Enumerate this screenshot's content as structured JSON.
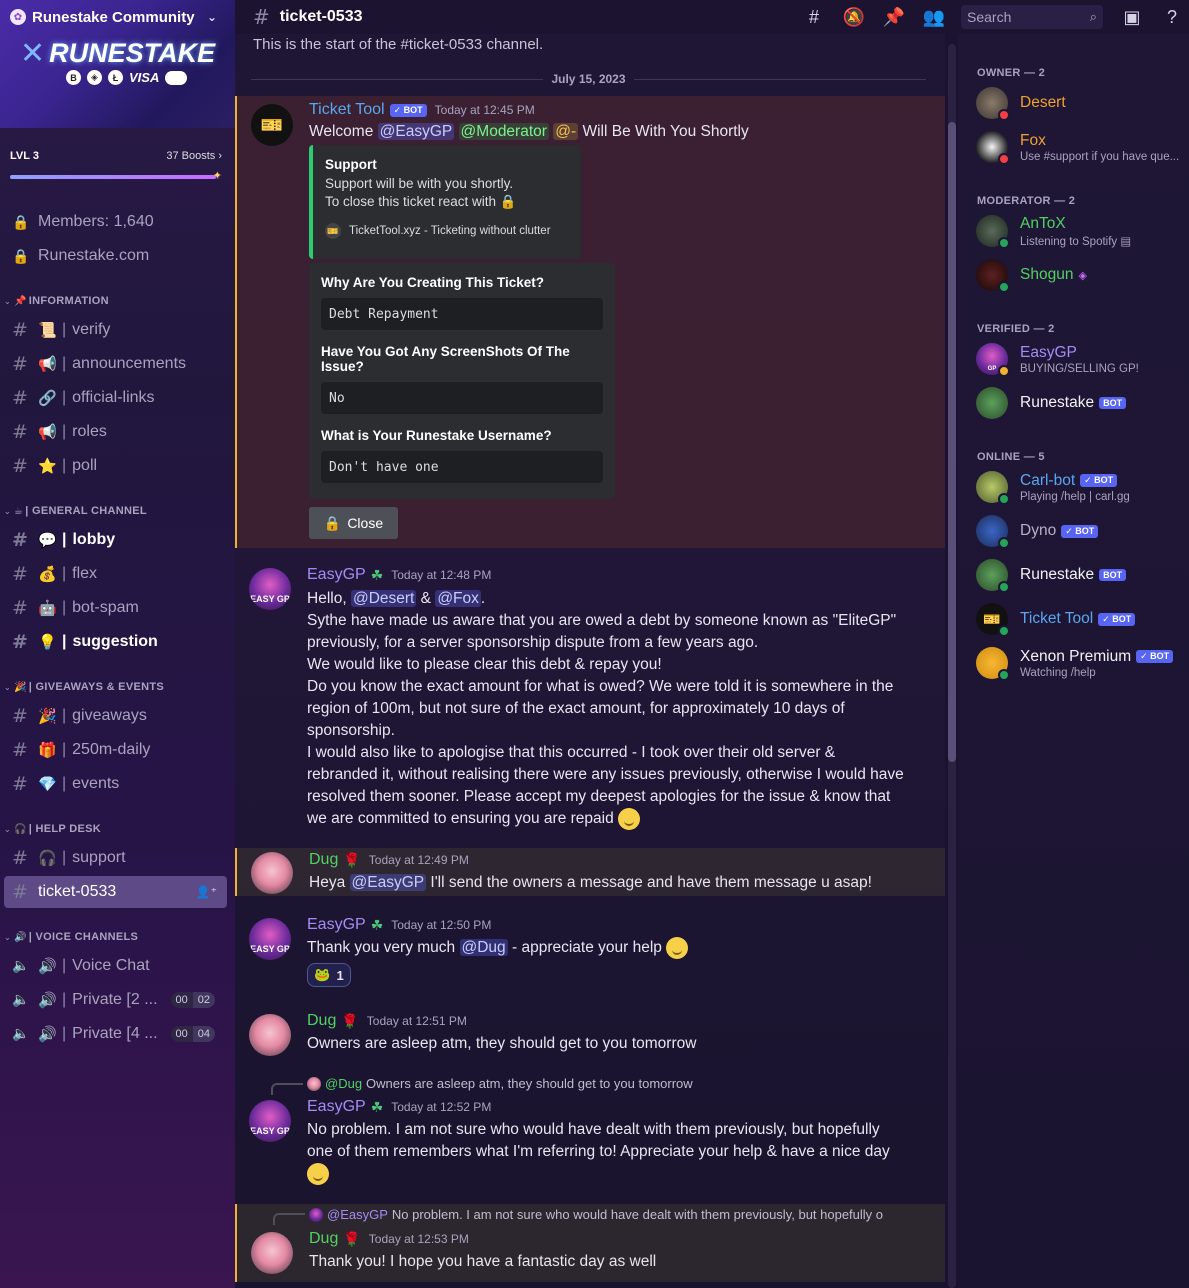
{
  "server": {
    "name": "Runestake Community",
    "banner_word": "RUNESTAKE",
    "banner_payments": [
      "B",
      "◈",
      "Ł",
      "VISA"
    ],
    "level": "LVL 3",
    "boosts": "37 Boosts",
    "boost_progress": 0.98
  },
  "sidebar": {
    "locked": [
      {
        "label": "Members: 1,640"
      },
      {
        "label": "Runestake.com"
      }
    ],
    "categories": [
      {
        "label": "INFORMATION",
        "emoji": "📌"
      },
      {
        "label": "| GENERAL CHANNEL",
        "emoji": "☕"
      },
      {
        "label": "| GIVEAWAYS & EVENTS",
        "emoji": "🎉"
      },
      {
        "label": "| HELP DESK",
        "emoji": "🎧"
      },
      {
        "label": "| VOICE CHANNELS",
        "emoji": "🔊"
      }
    ],
    "channels": [
      {
        "emoji": "📜",
        "label": "verify"
      },
      {
        "emoji": "📢",
        "label": "announcements"
      },
      {
        "emoji": "🔗",
        "label": "official-links"
      },
      {
        "emoji": "📢",
        "label": "roles"
      },
      {
        "emoji": "⭐",
        "label": "poll"
      },
      {
        "emoji": "💬",
        "label": "lobby"
      },
      {
        "emoji": "💰",
        "label": "flex"
      },
      {
        "emoji": "🤖",
        "label": "bot-spam"
      },
      {
        "emoji": "💡",
        "label": "suggestion"
      },
      {
        "emoji": "🎉",
        "label": "giveaways"
      },
      {
        "emoji": "🎁",
        "label": "250m-daily"
      },
      {
        "emoji": "💎",
        "label": "events"
      },
      {
        "emoji": "🎧",
        "label": "support"
      },
      {
        "emoji": "",
        "label": "ticket-0533"
      },
      {
        "emoji": "🔊",
        "label": "Voice Chat"
      },
      {
        "emoji": "🔊",
        "label": "Private [2 ...",
        "count_a": "00",
        "count_b": "02"
      },
      {
        "emoji": "🔊",
        "label": "Private [4 ...",
        "count_a": "00",
        "count_b": "04"
      }
    ]
  },
  "topbar": {
    "channel": "ticket-0533",
    "search_placeholder": "Search"
  },
  "chat": {
    "start_text": "This is the start of the #ticket-0533 channel.",
    "date": "July 15, 2023",
    "messages": [
      {
        "author": "Ticket Tool",
        "bot": "✓ BOT",
        "time": "Today at 12:45 PM",
        "pre": "Welcome",
        "mentions": [
          "@EasyGP",
          "@Moderator",
          "@-"
        ],
        "post": "Will Be With You Shortly",
        "embed": {
          "title": "Support",
          "line1": "Support will be with you shortly.",
          "line2": "To close this ticket react with 🔒",
          "footer": "TicketTool.xyz - Ticketing without clutter"
        },
        "form": [
          {
            "q": "Why Are You Creating This Ticket?",
            "a": "Debt Repayment"
          },
          {
            "q": "Have You Got Any ScreenShots Of The Issue?",
            "a": "No"
          },
          {
            "q": "What is Your Runestake Username?",
            "a": "Don't have one"
          }
        ],
        "button": "Close"
      },
      {
        "author": "EasyGP",
        "time": "Today at 12:48 PM",
        "hello": "Hello,",
        "m1": "@Desert",
        "amp": "&",
        "m2": "@Fox",
        "dot": ".",
        "lines": [
          "Sythe have made us aware that you are owed a debt by someone known as \"EliteGP\"",
          "previously, for a server sponsorship dispute from a few years ago.",
          "We would like to please clear this debt & repay you!",
          "Do you know the exact amount for what is owed? We were told it is somewhere in the",
          "region of 100m, but not sure of the exact amount, for approximately 10 days of",
          "sponsorship.",
          "I would also like to apologise that this occurred - I took over their old server &",
          "rebranded it, without realising there were any issues previously, otherwise I would have",
          "resolved them sooner. Please accept my deepest apologies for the issue & know that",
          "we are committed to ensuring you are repaid"
        ]
      },
      {
        "author": "Dug",
        "time": "Today at 12:49 PM",
        "pre": "Heya",
        "mention": "@EasyGP",
        "post": "I'll send the owners a message and have them message u asap!"
      },
      {
        "author": "EasyGP",
        "time": "Today at 12:50 PM",
        "pre": "Thank you very much",
        "mention": "@Dug",
        "post": "- appreciate your help",
        "reaction_count": "1"
      },
      {
        "author": "Dug",
        "time": "Today at 12:51 PM",
        "text": "Owners are asleep atm, they should get to you tomorrow"
      },
      {
        "reply_name": "@Dug",
        "reply_text": "Owners are asleep atm, they should get to you tomorrow",
        "author": "EasyGP",
        "time": "Today at 12:52 PM",
        "line1": "No problem. I am not sure who would have dealt with them previously, but hopefully",
        "line2": "one of them remembers what I'm referring to! Appreciate your help & have a nice day"
      },
      {
        "reply_name": "@EasyGP",
        "reply_text": "No problem. I am not sure who would have dealt with them previously, but hopefully o",
        "author": "Dug",
        "time": "Today at 12:53 PM",
        "text": "Thank you! I hope you have a fantastic day as well"
      }
    ]
  },
  "members": {
    "groups": [
      {
        "label": "OWNER — 2"
      },
      {
        "label": "MODERATOR — 2"
      },
      {
        "label": "VERIFIED — 2"
      },
      {
        "label": "ONLINE — 5"
      }
    ],
    "list": [
      {
        "name": "Desert",
        "sub": ""
      },
      {
        "name": "Fox",
        "sub": "Use #support if you have que..."
      },
      {
        "name": "AnToX",
        "sub": "Listening to Spotify"
      },
      {
        "name": "Shogun",
        "sub": ""
      },
      {
        "name": "EasyGP",
        "sub": "BUYING/SELLING GP!"
      },
      {
        "name": "Runestake",
        "sub": "",
        "bot": "BOT"
      },
      {
        "name": "Carl-bot",
        "sub": "Playing /help | carl.gg",
        "bot": "✓ BOT"
      },
      {
        "name": "Dyno",
        "sub": "",
        "bot": "✓ BOT"
      },
      {
        "name": "Runestake",
        "sub": "",
        "bot": "BOT"
      },
      {
        "name": "Ticket Tool",
        "sub": "",
        "bot": "✓ BOT"
      },
      {
        "name": "Xenon Premium",
        "sub": "Watching /help",
        "bot": "✓ BOT"
      }
    ]
  },
  "colors": {
    "accent": "#5865f2",
    "owner": "#f0a12e",
    "moderator": "#52d163",
    "verified": "#a58cf5",
    "online_status": "#23a55a",
    "dnd_status": "#f23f43",
    "highlight_bar": "#f0b232"
  },
  "icons": [
    "threads-icon",
    "mute-icon",
    "pin-icon",
    "members-icon",
    "search-icon",
    "inbox-icon",
    "help-icon"
  ]
}
